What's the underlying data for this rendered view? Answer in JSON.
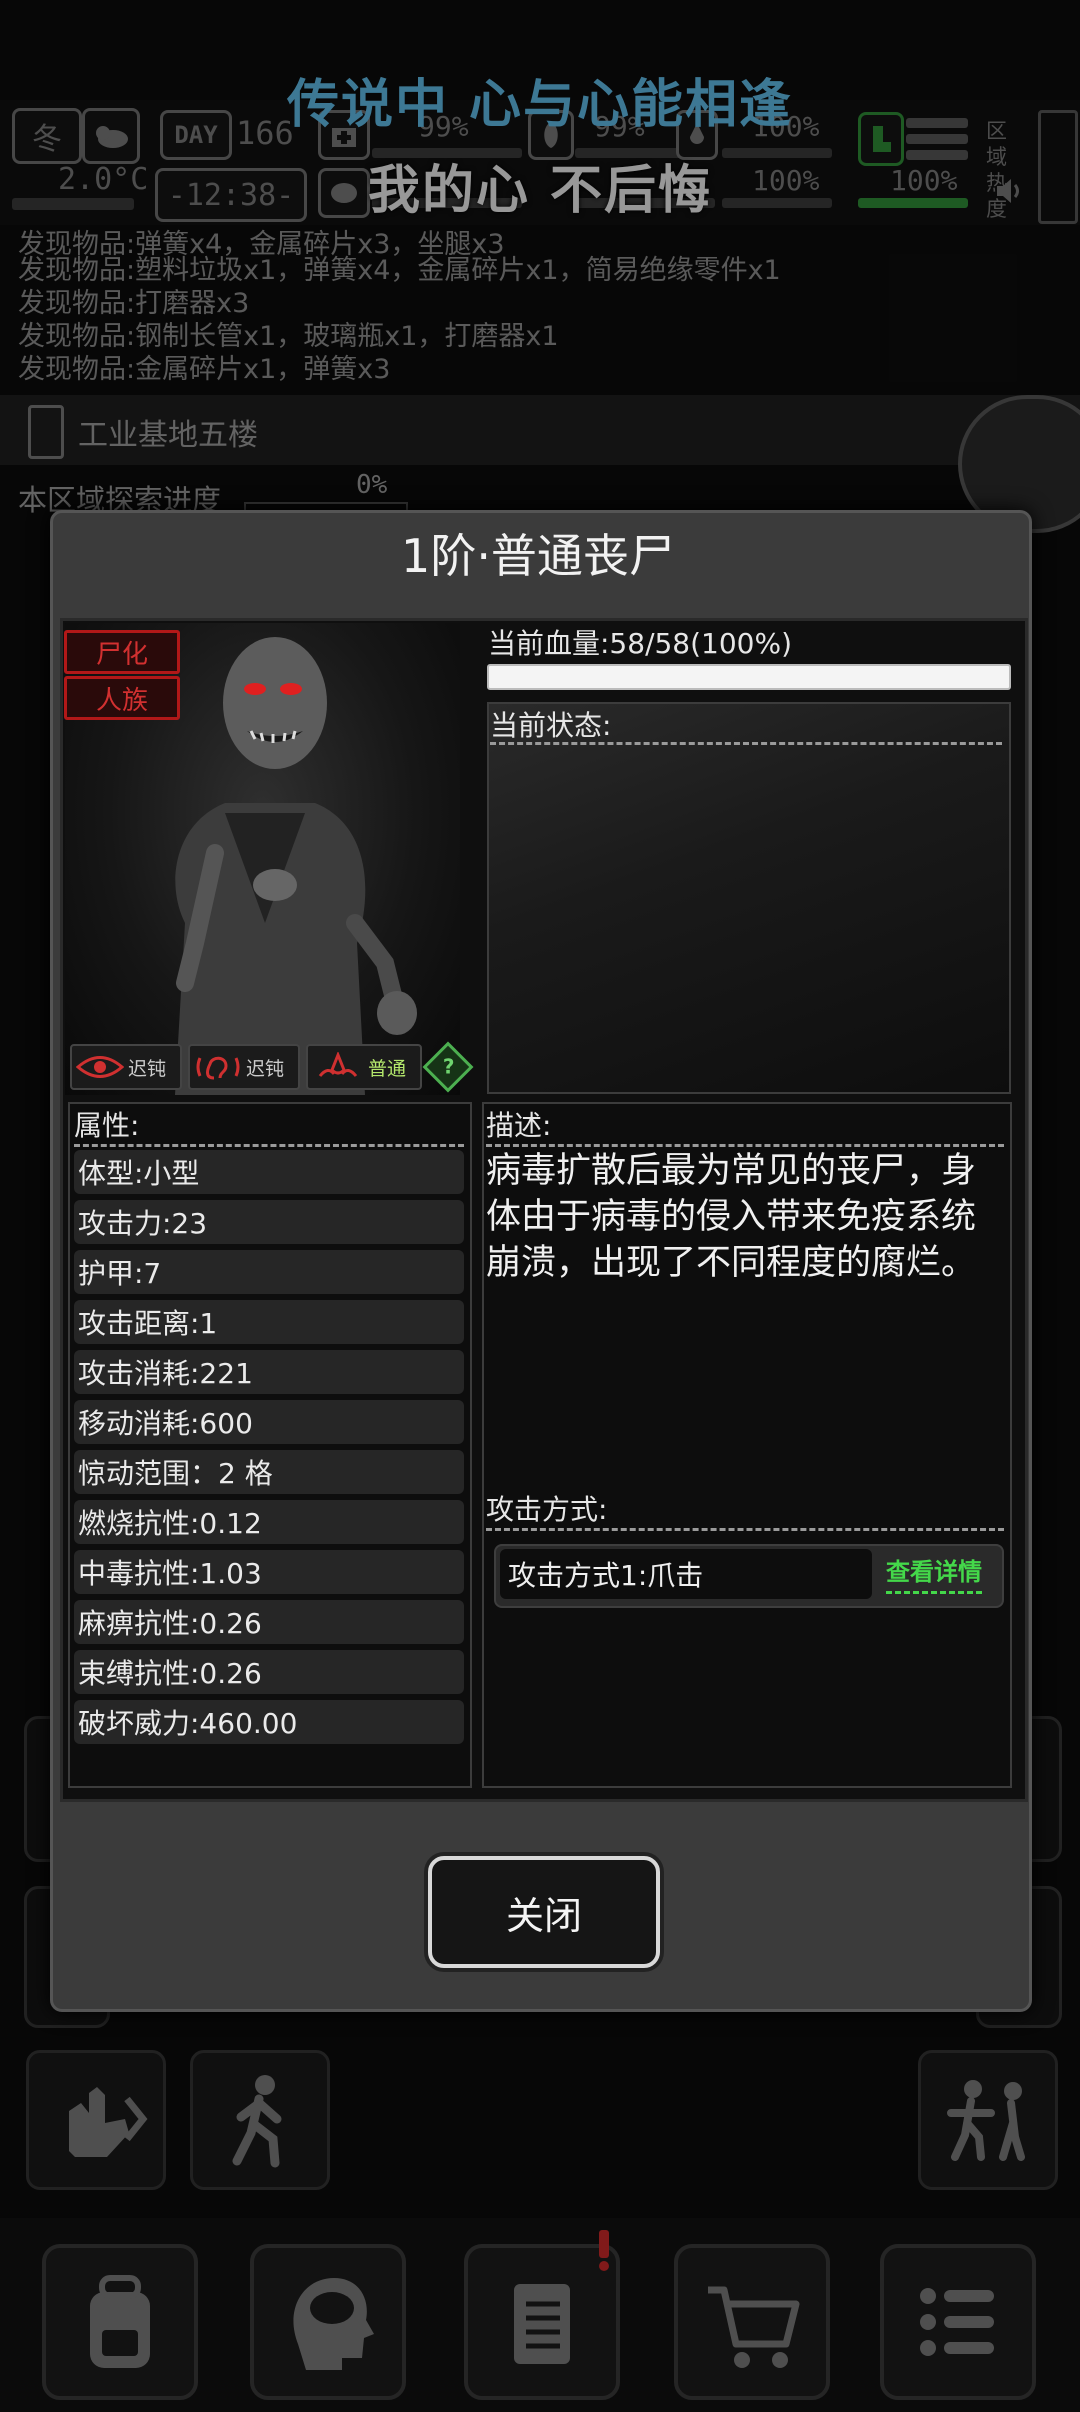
{
  "hud": {
    "season": "冬",
    "temperature": "2.0°C",
    "day_badge": "DAY",
    "day_number": "166",
    "clock": "-12:38-",
    "stat_top_1": "99%",
    "stat_top_2": "99%",
    "stat_top_3": "100%",
    "stat_bottom_3": "100%",
    "stat_bottom_4": "100%",
    "area_heat_label": "区域热度"
  },
  "lyrics": {
    "line1": "传说中 心与心能相逢",
    "line2": "我的心 不后悔"
  },
  "log": [
    "发现物品:弹簧x4，金属碎片x3，坐腿x3",
    "发现物品:塑料垃圾x1，弹簧x4，金属碎片x1，简易绝缘零件x1",
    "发现物品:打磨器x3",
    "发现物品:钢制长管x1，玻璃瓶x1，打磨器x1",
    "发现物品:金属碎片x1，弹簧x3"
  ],
  "location": {
    "name": "工业基地五楼",
    "explore_label": "本区域探索进度",
    "explore_value": "0%"
  },
  "modal": {
    "title": "1阶·普通丧尸",
    "tags": [
      "尸化",
      "人族"
    ],
    "senses": [
      {
        "icon": "eye-icon",
        "label": "迟钝"
      },
      {
        "icon": "ear-icon",
        "label": "迟钝"
      },
      {
        "icon": "nose-icon",
        "label": "普通"
      }
    ],
    "hp_label": "当前血量:58/58(100%)",
    "hp_fraction": 1.0,
    "status_label": "当前状态:",
    "attr_label": "属性:",
    "attributes": [
      "体型:小型",
      "攻击力:23",
      "护甲:7",
      "攻击距离:1",
      "攻击消耗:221",
      "移动消耗:600",
      "惊动范围：2 格",
      "燃烧抗性:0.12",
      "中毒抗性:1.03",
      "麻痹抗性:0.26",
      "束缚抗性:0.26",
      "破坏威力:460.00"
    ],
    "desc_label": "描述:",
    "description": "病毒扩散后最为常见的丧尸，身体由于病毒的侵入带来免疫系统崩溃，出现了不同程度的腐烂。",
    "attack_label": "攻击方式:",
    "attack_name": "攻击方式1:爪击",
    "attack_detail": "查看详情",
    "close_label": "关闭"
  },
  "colors": {
    "lyric_blue": "#5fb9e4",
    "tag_red": "#d23030",
    "detail_green": "#44d84a"
  }
}
